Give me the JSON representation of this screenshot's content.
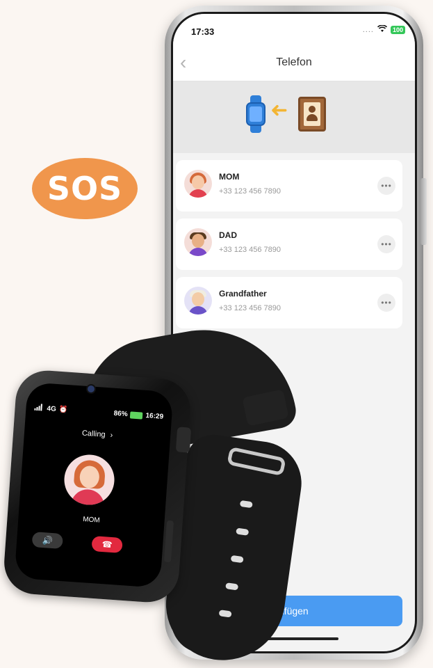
{
  "badge": {
    "label": "SOS",
    "color": "#f0964c"
  },
  "phone": {
    "status": {
      "time": "17:33",
      "signal_dots": "....",
      "battery": "100"
    },
    "nav": {
      "back_icon": "chevron-left-icon",
      "title": "Telefon"
    },
    "contacts": [
      {
        "name": "MOM",
        "phone": "+33 123 456 7890",
        "more": "•••"
      },
      {
        "name": "DAD",
        "phone": "+33 123 456 7890",
        "more": "•••"
      },
      {
        "name": "Grandfather",
        "phone": "+33 123 456 7890",
        "more": "•••"
      }
    ],
    "add_button": {
      "label": "inzufügen",
      "color": "#4a9bf2"
    }
  },
  "watch": {
    "network": "4G",
    "battery_percent": "86%",
    "time": "16:29",
    "calling_label": "Calling",
    "calling_chevron": "›",
    "contact_name": "MOM",
    "speaker_icon": "🔊",
    "hangup_icon": "☎",
    "hangup_color": "#e2293f"
  }
}
